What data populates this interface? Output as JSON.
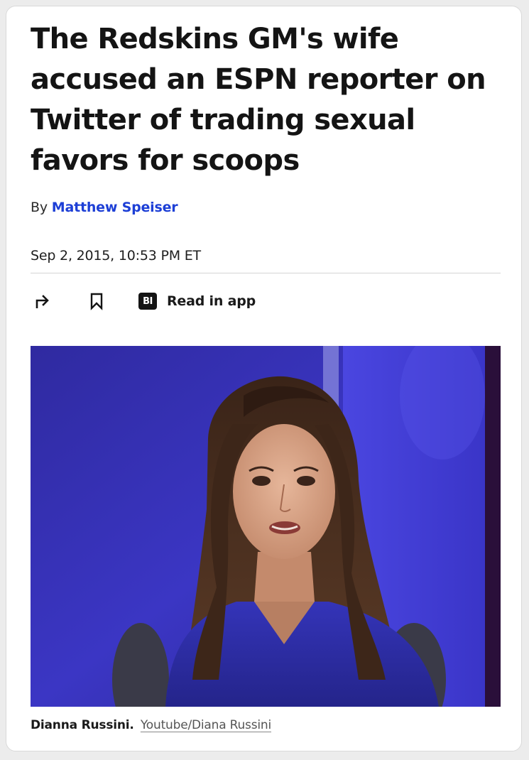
{
  "article": {
    "headline": "The Redskins GM's wife accused an ESPN reporter on Twitter of trading sexual favors for scoops",
    "byline_prefix": "By",
    "author": "Matthew Speiser",
    "date": "Sep 2, 2015, 10:53 PM ET"
  },
  "actions": {
    "share_icon": "share-arrow-icon",
    "bookmark_icon": "bookmark-icon",
    "app_badge": "BI",
    "app_label": "Read in app"
  },
  "image": {
    "alt": "Woman with long dark hair in blue top in a TV studio",
    "caption_name": "Dianna Russini.",
    "caption_credit": "Youtube/Diana Russini"
  },
  "colors": {
    "author_link": "#1d3fd6",
    "studio_blue": "#3330a8"
  }
}
